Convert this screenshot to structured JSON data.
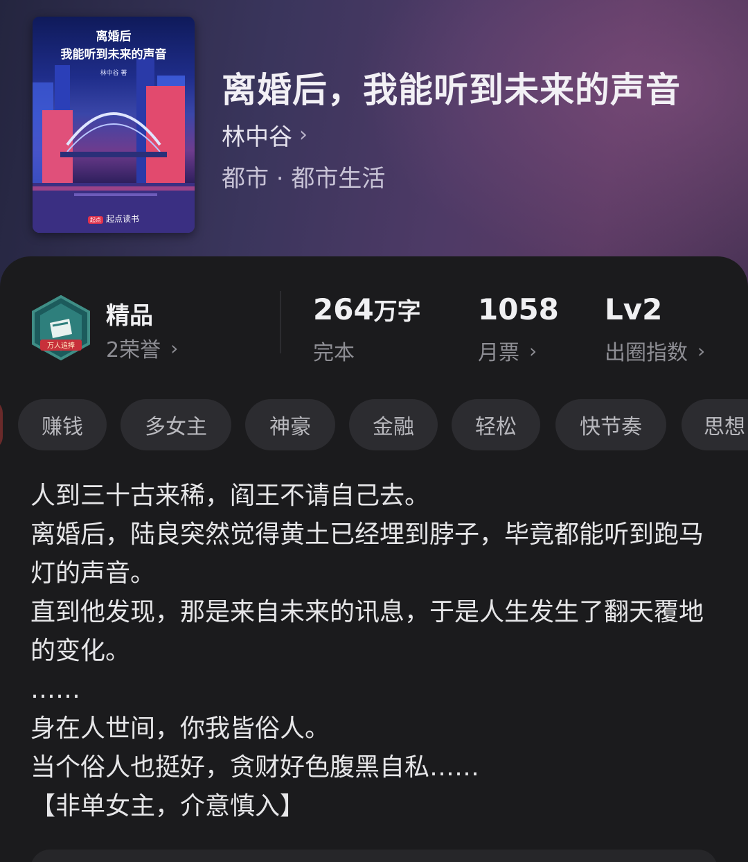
{
  "book": {
    "title": "离婚后，我能听到未来的声音",
    "author": "林中谷",
    "genre": "都市 · 都市生活",
    "cover": {
      "title_line1": "离婚后",
      "title_line2": "我能听到未来的声音",
      "author": "林中谷 著",
      "brand_tag": "起点",
      "brand": "起点读书"
    }
  },
  "badge": {
    "icon": "honor-badge-icon",
    "ribbon": "万人追捧",
    "label": "精品",
    "sub": "2荣誉"
  },
  "stats": [
    {
      "value": "264",
      "unit": "万字",
      "label": "完本",
      "has_arrow": false
    },
    {
      "value": "1058",
      "unit": "",
      "label": "月票",
      "has_arrow": true
    },
    {
      "value": "Lv2",
      "unit": "",
      "label": "出圈指数",
      "has_arrow": true
    }
  ],
  "tags": [
    "赚钱",
    "多女主",
    "神豪",
    "金融",
    "轻松",
    "快节奏",
    "思想"
  ],
  "description": [
    "人到三十古来稀，阎王不请自己去。",
    "离婚后，陆良突然觉得黄土已经埋到脖子，毕竟都能听到跑马灯的声音。",
    "直到他发现，那是来自未来的讯息，于是人生发生了翻天覆地的变化。",
    "……",
    "身在人世间，你我皆俗人。",
    "当个俗人也挺好，贪财好色腹黑自私……",
    "【非单女主，介意慎入】"
  ],
  "colors": {
    "hero_start": "#24253f",
    "hero_end": "#5a3a63",
    "sheet": "#1b1b1d",
    "tag_bg": "#2c2c30",
    "muted": "#8e8e94"
  }
}
